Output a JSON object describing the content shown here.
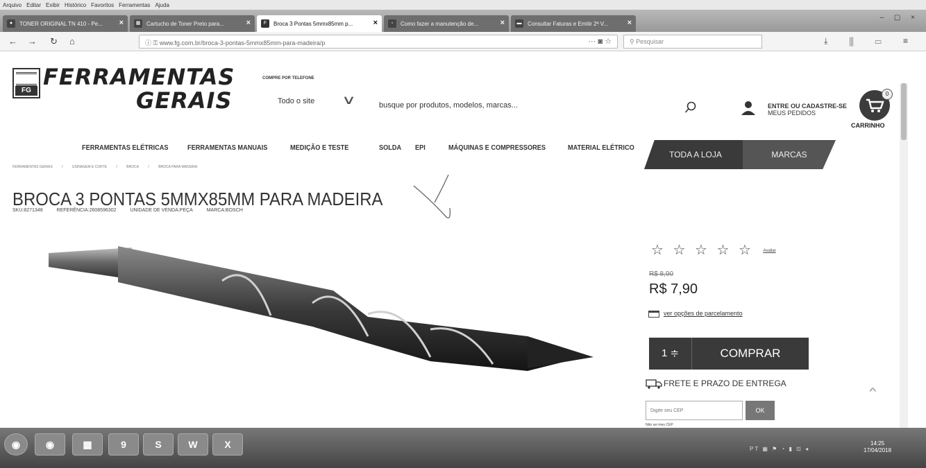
{
  "browser": {
    "menu": [
      "Arquivo",
      "Editar",
      "Exibir",
      "Histórico",
      "Favoritos",
      "Ferramentas",
      "Ajuda"
    ],
    "tabs": [
      {
        "label": "TONER ORIGINAL TN 410 - Pe...",
        "active": false
      },
      {
        "label": "Cartucho de Toner Preto para...",
        "active": false
      },
      {
        "label": "Broca 3 Pontas 5mmx85mm p...",
        "active": true
      },
      {
        "label": "Como fazer a manutenção de...",
        "active": false
      },
      {
        "label": "Consultar Faturas e Emitir 2ª V...",
        "active": false
      }
    ],
    "url": "www.fg.com.br/broca-3-pontas-5mmx85mm-para-madeira/p",
    "search_placeholder": "Pesquisar"
  },
  "header": {
    "logo_line1": "FERRAMENTAS",
    "logo_line2": "GERAIS",
    "logo_badge": "FG",
    "phone_label": "COMPRE POR TELEFONE",
    "scope": "Todo o site",
    "search_placeholder": "busque por produtos, modelos, marcas...",
    "login": "ENTRE OU CADASTRE-SE",
    "orders": "MEUS PEDIDOS",
    "cart_label": "CARRINHO",
    "cart_count": "0"
  },
  "nav": {
    "items": [
      "FERRAMENTAS ELÉTRICAS",
      "FERRAMENTAS MANUAIS",
      "MEDIÇÃO E TESTE",
      "SOLDA",
      "EPI",
      "MÁQUINAS E COMPRESSORES",
      "MATERIAL ELÉTRICO"
    ],
    "all_store": "TODA A LOJA",
    "brands": "MARCAS"
  },
  "breadcrumb": [
    "FERRAMENTAS GERAIS",
    "/",
    "USINAGEM E CORTE",
    "/",
    "BROCA",
    "/",
    "BROCA PARA MADEIRA"
  ],
  "product": {
    "title": "BROCA 3 PONTAS 5MMX85MM PARA MADEIRA",
    "sku": "SKU:8271348",
    "reference": "REFERÊNCIA:2608596302",
    "unit": "UNIDADE DE VENDA:PEÇA",
    "brand": "MARCA:BOSCH",
    "stars": "☆ ☆ ☆ ☆ ☆",
    "rating_value": 0,
    "review_link": "Avaliar",
    "old_price": "R$ 8,90",
    "price": "R$ 7,90",
    "installments": "ver opções de parcelamento",
    "quantity": "1 ≑",
    "buy_label": "COMPRAR",
    "shipping_label": "FRETE E PRAZO DE ENTREGA",
    "cep_placeholder": "Digite seu CEP",
    "cep_ok": "OK",
    "no_cep": "Não sei meu CEP"
  },
  "taskbar": {
    "apps": [
      "◉",
      "◉",
      "▦",
      "9",
      "S",
      "W",
      "X"
    ],
    "lang": "PT",
    "time": "14:25",
    "date": "17/04/2018"
  }
}
